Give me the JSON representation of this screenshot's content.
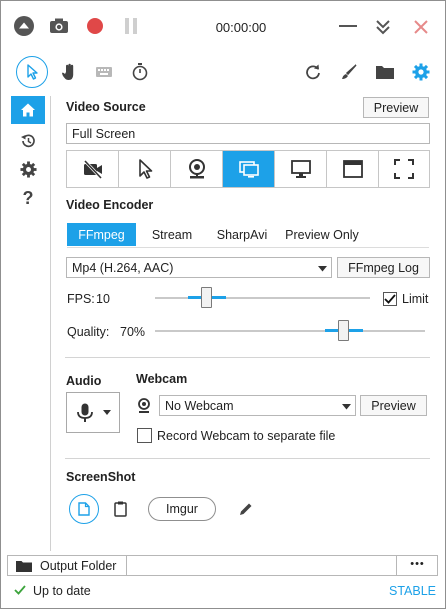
{
  "toolbar": {
    "timer": "00:00:00",
    "icons": [
      "menu-up-icon",
      "camera-icon",
      "record-icon",
      "pause-icon",
      "minimize-icon",
      "collapse-icon",
      "close-icon"
    ]
  },
  "tools": {
    "icons": [
      "cursor-icon",
      "hand-icon",
      "keyboard-icon",
      "stopwatch-icon",
      "refresh-icon",
      "brush-icon",
      "folder-icon",
      "gear-icon"
    ]
  },
  "sidebar": {
    "icons": [
      "home-icon",
      "history-icon",
      "settings-icon",
      "help-icon"
    ],
    "help_label": "?"
  },
  "video_source": {
    "title": "Video Source",
    "preview_label": "Preview",
    "value": "Full Screen",
    "sources": [
      "no-video-icon",
      "pointer-icon",
      "webcam-icon",
      "screen-icon",
      "monitor-icon",
      "window-icon",
      "region-icon"
    ],
    "active_index": 3
  },
  "video_encoder": {
    "title": "Video Encoder",
    "tabs": [
      "FFmpeg",
      "Stream",
      "SharpAvi",
      "Preview Only"
    ],
    "active_tab": 0,
    "codec": "Mp4 (H.264, AAC)",
    "log_label": "FFmpeg Log",
    "fps_label": "FPS:",
    "fps_value": "10",
    "fps_level": 0.24,
    "limit_label": "Limit",
    "limit_checked": true,
    "quality_label": "Quality:",
    "quality_value": "70%",
    "quality_level": 0.7
  },
  "audio": {
    "title": "Audio"
  },
  "webcam": {
    "title": "Webcam",
    "selected": "No Webcam",
    "preview_label": "Preview",
    "separate_label": "Record Webcam to separate file",
    "separate_checked": false
  },
  "screenshot": {
    "title": "ScreenShot",
    "imgur_label": "Imgur"
  },
  "footer": {
    "output_label": "Output Folder",
    "more_label": "•••"
  },
  "status": {
    "text": "Up to date",
    "channel": "STABLE"
  },
  "colors": {
    "accent": "#1da1e8",
    "record": "#e04848",
    "check": "#3ca43c"
  }
}
